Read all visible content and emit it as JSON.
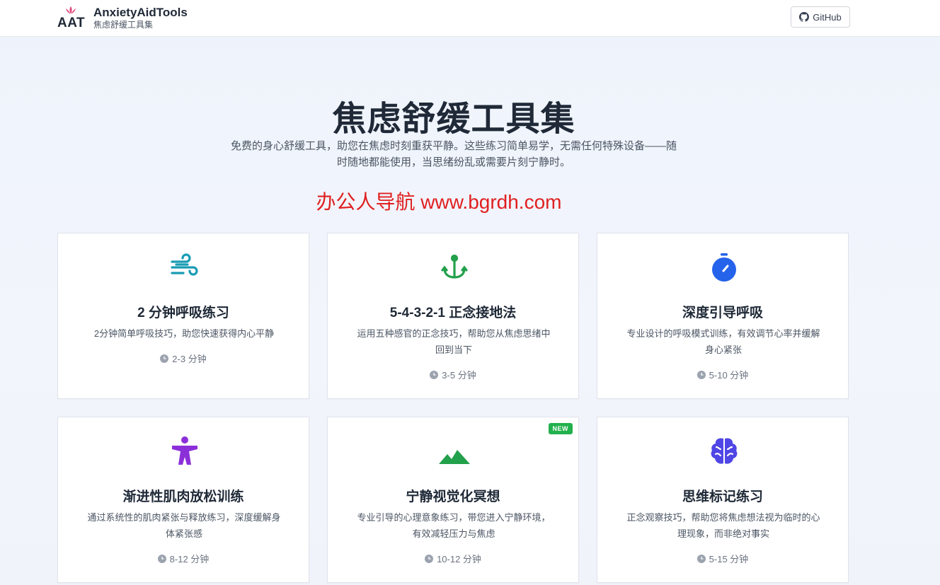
{
  "header": {
    "logo_text": "AAT",
    "brand_name": "AnxietyAidTools",
    "brand_sub": "焦虑舒缓工具集",
    "github_label": "GitHub"
  },
  "hero": {
    "title": "焦虑舒缓工具集",
    "description_line1": "免费的身心舒缓工具，助您在焦虑时刻重获平静。这些练习简单易学，无需任何特殊设备——随",
    "description_line2": "时随地都能使用，当思绪纷乱或需要片刻宁静时。",
    "promo": "办公人导航 www.bgrdh.com"
  },
  "colors": {
    "teal": "#1a9bb5",
    "green": "#22a04b",
    "blue": "#2563eb",
    "purple": "#8b2fd9",
    "indigo": "#4f46e5",
    "promo_red": "#e02020",
    "badge_green": "#22b14c"
  },
  "cards": [
    {
      "icon": "wind-icon",
      "title": "2 分钟呼吸练习",
      "desc1": "2分钟简单呼吸技巧，助您快速获得内心平静",
      "desc2": "",
      "time": "2-3 分钟"
    },
    {
      "icon": "anchor-icon",
      "title": "5-4-3-2-1 正念接地法",
      "desc1": "运用五种感官的正念技巧，帮助您从焦虑思绪中",
      "desc2": "回到当下",
      "time": "3-5 分钟"
    },
    {
      "icon": "stopwatch-icon",
      "title": "深度引导呼吸",
      "desc1": "专业设计的呼吸模式训练，有效调节心率并缓解",
      "desc2": "身心紧张",
      "time": "5-10 分钟"
    },
    {
      "icon": "person-icon",
      "title": "渐进性肌肉放松训练",
      "desc1": "通过系统性的肌肉紧张与释放练习，深度缓解身",
      "desc2": "体紧张感",
      "time": "8-12 分钟"
    },
    {
      "icon": "mountain-icon",
      "title": "宁静视觉化冥想",
      "desc1": "专业引导的心理意象练习，带您进入宁静环境，",
      "desc2": "有效减轻压力与焦虑",
      "time": "10-12 分钟",
      "badge": "NEW"
    },
    {
      "icon": "brain-icon",
      "title": "思维标记练习",
      "desc1": "正念观察技巧，帮助您将焦虑想法视为临时的心",
      "desc2": "理现象，而非绝对事实",
      "time": "5-15 分钟"
    }
  ]
}
